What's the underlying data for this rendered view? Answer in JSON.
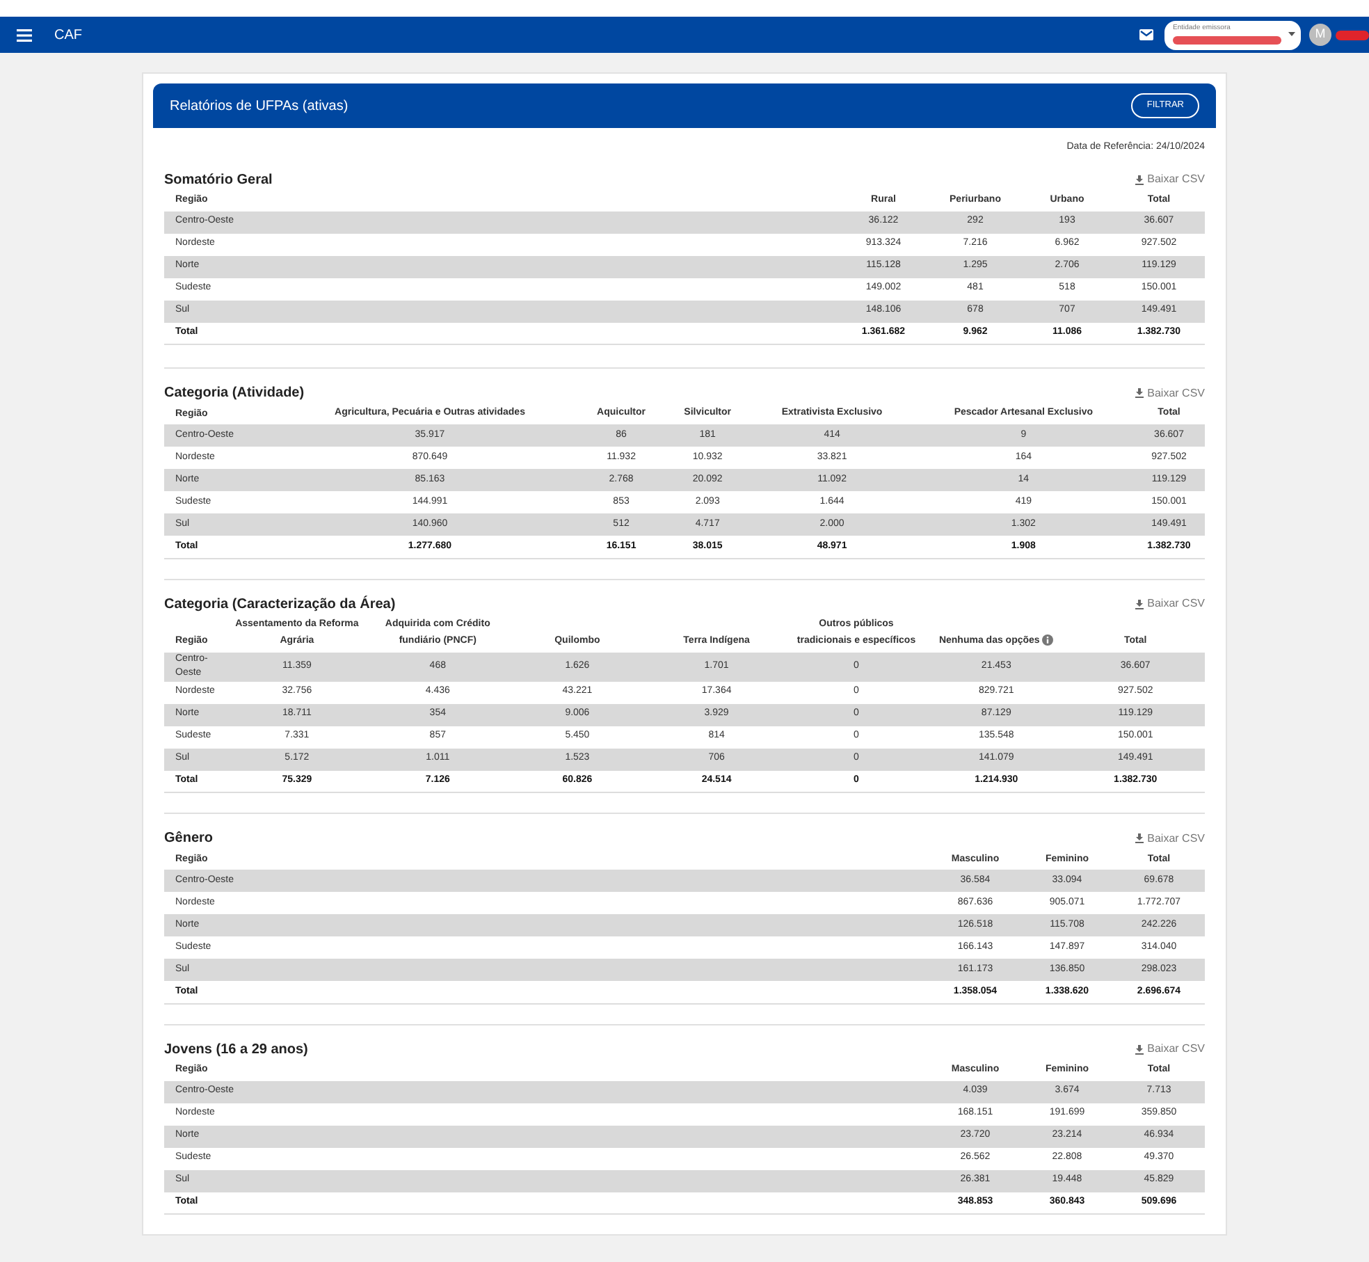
{
  "app_bar": {
    "app_name": "CAF",
    "entity_field": {
      "label": "Entidade emissora"
    },
    "avatar_initial": "M"
  },
  "report": {
    "title": "Relatórios de UFPAs (ativas)",
    "filter_button": "FILTRAR",
    "reference_date": "Data de Referência: 24/10/2024",
    "sections": [
      {
        "title": "Somatório Geral",
        "csv_button": "Baixar CSV",
        "columns": [
          {
            "label": "Região"
          },
          {
            "label": "Rural"
          },
          {
            "label": "Periurbano"
          },
          {
            "label": "Urbano"
          },
          {
            "label": "Total"
          }
        ],
        "rows": [
          [
            "Centro-Oeste",
            "36.122",
            "292",
            "193",
            "36.607"
          ],
          [
            "Nordeste",
            "913.324",
            "7.216",
            "6.962",
            "927.502"
          ],
          [
            "Norte",
            "115.128",
            "1.295",
            "2.706",
            "119.129"
          ],
          [
            "Sudeste",
            "149.002",
            "481",
            "518",
            "150.001"
          ],
          [
            "Sul",
            "148.106",
            "678",
            "707",
            "149.491"
          ]
        ],
        "total": [
          "Total",
          "1.361.682",
          "9.962",
          "11.086",
          "1.382.730"
        ]
      },
      {
        "title": "Categoria (Atividade)",
        "csv_button": "Baixar CSV",
        "columns": [
          {
            "label": "Região"
          },
          {
            "label": "Agricultura, Pecuária e Outras atividades"
          },
          {
            "label": "Aquicultor"
          },
          {
            "label": "Silvicultor"
          },
          {
            "label": "Extrativista Exclusivo"
          },
          {
            "label": "Pescador Artesanal Exclusivo"
          },
          {
            "label": "Total"
          }
        ],
        "rows": [
          [
            "Centro-Oeste",
            "35.917",
            "86",
            "181",
            "414",
            "9",
            "36.607"
          ],
          [
            "Nordeste",
            "870.649",
            "11.932",
            "10.932",
            "33.821",
            "164",
            "927.502"
          ],
          [
            "Norte",
            "85.163",
            "2.768",
            "20.092",
            "11.092",
            "14",
            "119.129"
          ],
          [
            "Sudeste",
            "144.991",
            "853",
            "2.093",
            "1.644",
            "419",
            "150.001"
          ],
          [
            "Sul",
            "140.960",
            "512",
            "4.717",
            "2.000",
            "1.302",
            "149.491"
          ]
        ],
        "total": [
          "Total",
          "1.277.680",
          "16.151",
          "38.015",
          "48.971",
          "1.908",
          "1.382.730"
        ]
      },
      {
        "title": "Categoria (Caracterização da Área)",
        "csv_button": "Baixar CSV",
        "columns": [
          {
            "label": "Região"
          },
          {
            "label": "Assentamento da Reforma Agrária"
          },
          {
            "label": "Adquirida com Crédito fundiário (PNCF)"
          },
          {
            "label": "Quilombo"
          },
          {
            "label": "Terra Indígena"
          },
          {
            "label": "Outros públicos tradicionais e específicos"
          },
          {
            "label": "Nenhuma das opções",
            "info": true
          },
          {
            "label": "Total"
          }
        ],
        "rows": [
          [
            "Centro-Oeste",
            "11.359",
            "468",
            "1.626",
            "1.701",
            "0",
            "21.453",
            "36.607"
          ],
          [
            "Nordeste",
            "32.756",
            "4.436",
            "43.221",
            "17.364",
            "0",
            "829.721",
            "927.502"
          ],
          [
            "Norte",
            "18.711",
            "354",
            "9.006",
            "3.929",
            "0",
            "87.129",
            "119.129"
          ],
          [
            "Sudeste",
            "7.331",
            "857",
            "5.450",
            "814",
            "0",
            "135.548",
            "150.001"
          ],
          [
            "Sul",
            "5.172",
            "1.011",
            "1.523",
            "706",
            "0",
            "141.079",
            "149.491"
          ]
        ],
        "total": [
          "Total",
          "75.329",
          "7.126",
          "60.826",
          "24.514",
          "0",
          "1.214.930",
          "1.382.730"
        ]
      },
      {
        "title": "Gênero",
        "csv_button": "Baixar CSV",
        "columns": [
          {
            "label": "Região"
          },
          {
            "label": "Masculino"
          },
          {
            "label": "Feminino"
          },
          {
            "label": "Total"
          }
        ],
        "rows": [
          [
            "Centro-Oeste",
            "36.584",
            "33.094",
            "69.678"
          ],
          [
            "Nordeste",
            "867.636",
            "905.071",
            "1.772.707"
          ],
          [
            "Norte",
            "126.518",
            "115.708",
            "242.226"
          ],
          [
            "Sudeste",
            "166.143",
            "147.897",
            "314.040"
          ],
          [
            "Sul",
            "161.173",
            "136.850",
            "298.023"
          ]
        ],
        "total": [
          "Total",
          "1.358.054",
          "1.338.620",
          "2.696.674"
        ]
      },
      {
        "title": "Jovens (16 a 29 anos)",
        "csv_button": "Baixar CSV",
        "columns": [
          {
            "label": "Região"
          },
          {
            "label": "Masculino"
          },
          {
            "label": "Feminino"
          },
          {
            "label": "Total"
          }
        ],
        "rows": [
          [
            "Centro-Oeste",
            "4.039",
            "3.674",
            "7.713"
          ],
          [
            "Nordeste",
            "168.151",
            "191.699",
            "359.850"
          ],
          [
            "Norte",
            "23.720",
            "23.214",
            "46.934"
          ],
          [
            "Sudeste",
            "26.562",
            "22.808",
            "49.370"
          ],
          [
            "Sul",
            "26.381",
            "19.448",
            "45.829"
          ]
        ],
        "total": [
          "Total",
          "348.853",
          "360.843",
          "509.696"
        ]
      }
    ]
  }
}
